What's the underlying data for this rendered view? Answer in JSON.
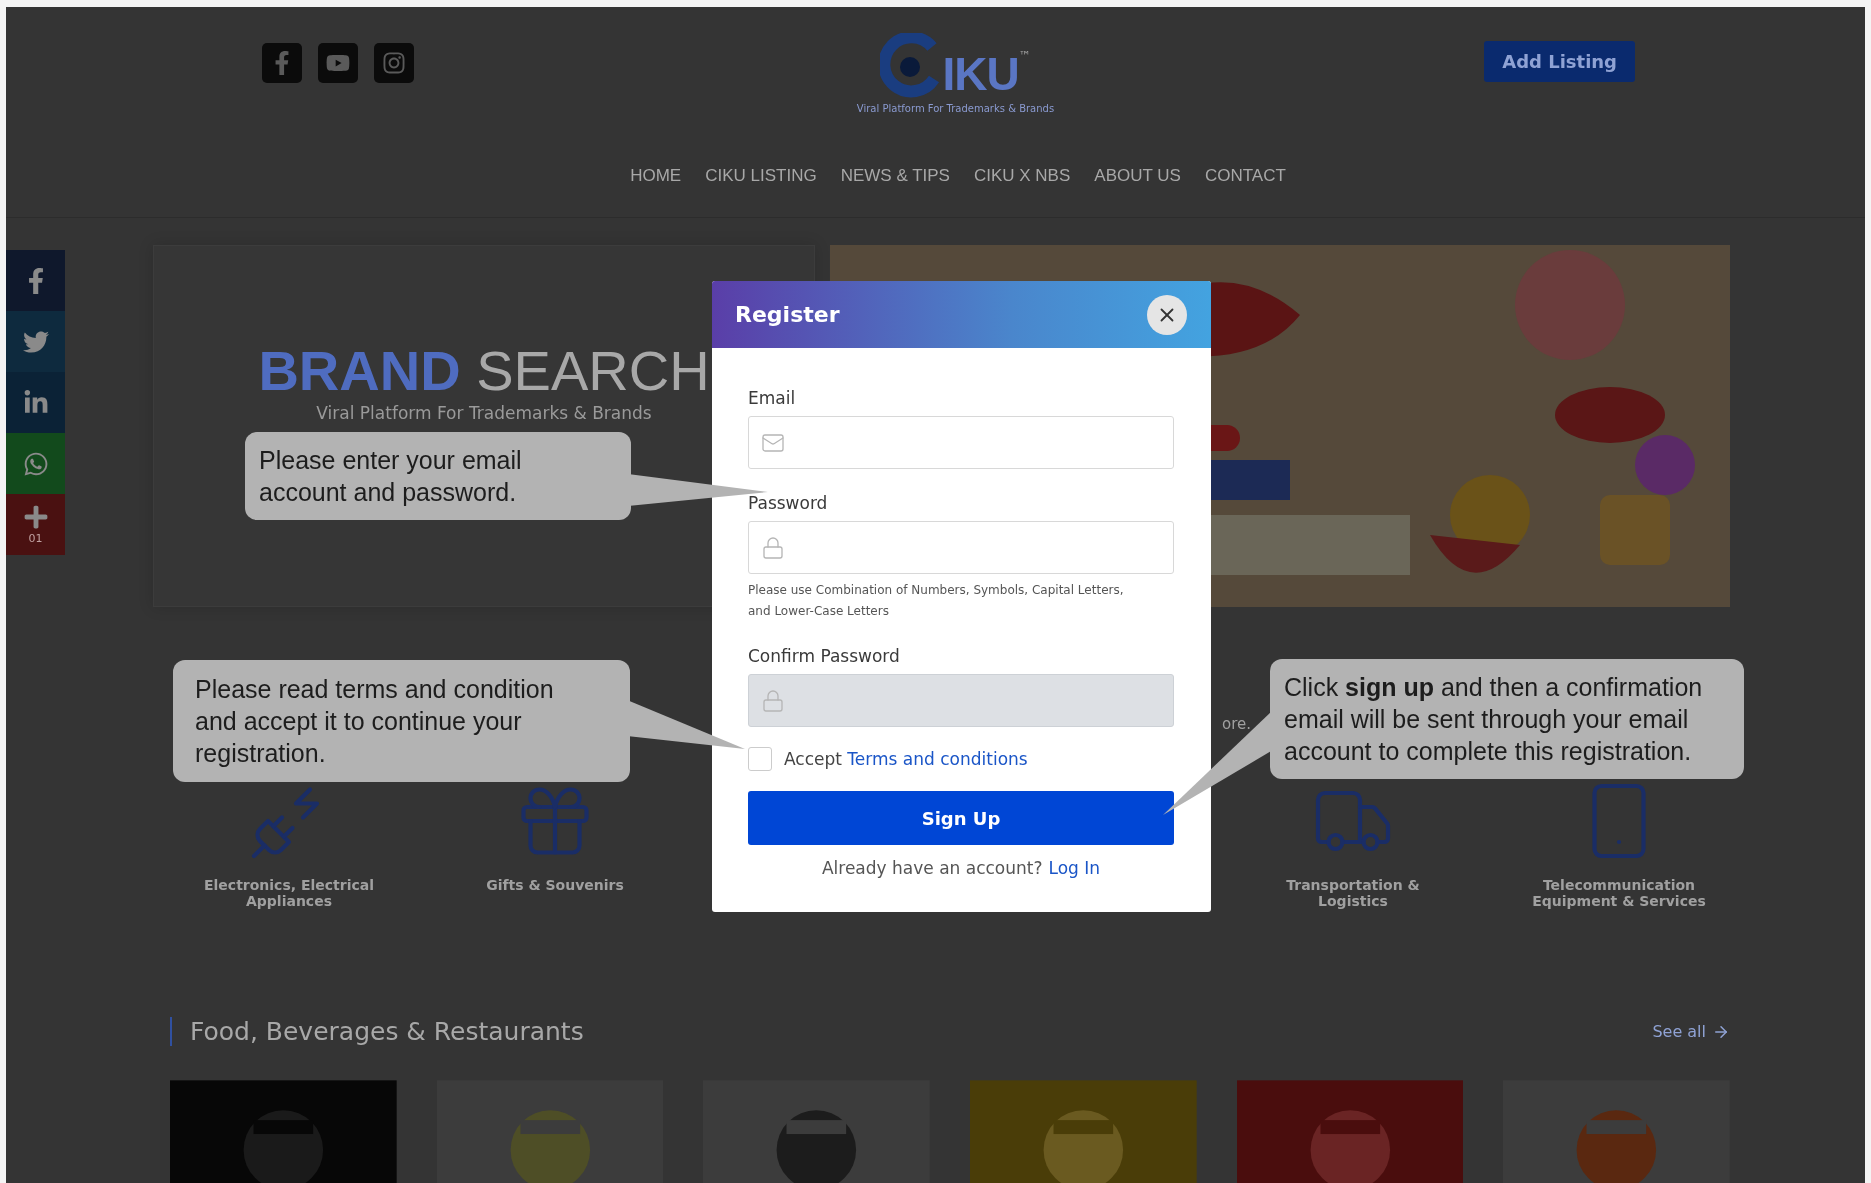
{
  "header": {
    "logo": {
      "wordmark": "IKU",
      "trademark": "™",
      "tagline": "Viral Platform For Trademarks & Brands"
    },
    "add_listing": "Add Listing"
  },
  "nav": [
    "HOME",
    "CIKU LISTING",
    "NEWS & TIPS",
    "CIKU X NBS",
    "ABOUT US",
    "CONTACT"
  ],
  "share_bar": {
    "count": "01"
  },
  "brand_search": {
    "title_bold": "BRAND",
    "title_light": "SEARCH",
    "subtitle": "Viral Platform For Trademarks & Brands"
  },
  "categories": {
    "link": "ore.",
    "items": [
      {
        "label": "Electronics, Electrical Appliances"
      },
      {
        "label": "Gifts & Souvenirs"
      },
      {
        "label": "Transportation & Logistics"
      },
      {
        "label": "Telecommunication Equipment & Services"
      }
    ]
  },
  "food_section": {
    "title": "Food, Beverages & Restaurants",
    "see_all": "See all"
  },
  "modal": {
    "title": "Register",
    "fields": [
      {
        "label": "Email",
        "kind": "email",
        "disabled": false
      },
      {
        "label": "Password",
        "kind": "password",
        "disabled": false,
        "hint": "Please use Combination of Numbers, Symbols, Capital Letters, and Lower-Case Letters"
      },
      {
        "label": "Confirm Password",
        "kind": "password",
        "disabled": true
      }
    ],
    "accept": {
      "checked": false,
      "text": "Accept",
      "link": "Terms and conditions"
    },
    "submit": "Sign Up",
    "login_prompt": {
      "text": "Already have an account?",
      "link": "Log In"
    }
  },
  "callouts": [
    {
      "text": "Please enter your email account and password."
    },
    {
      "text": "Please read terms and condition and accept it to continue your registration."
    },
    {
      "text": "Click **sign up** and then a confirmation email will be sent through your email account to complete this registration."
    }
  ]
}
